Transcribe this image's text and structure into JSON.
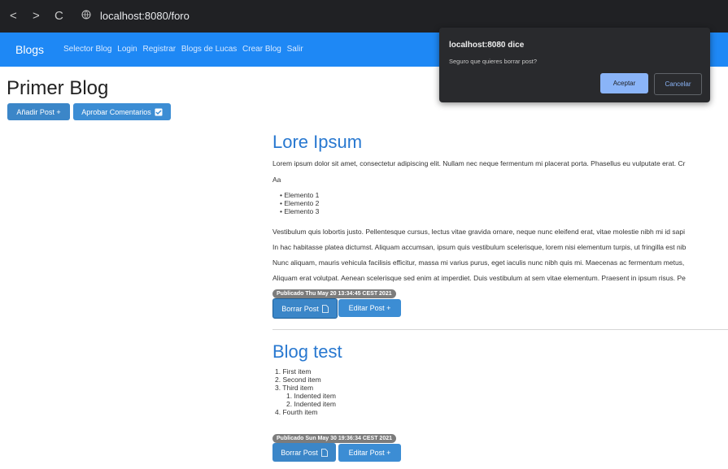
{
  "browser": {
    "back": "<",
    "forward": ">",
    "reload": "C",
    "url": "localhost:8080/foro"
  },
  "navbar": {
    "brand": "Blogs",
    "links": [
      "Selector Blog",
      "Login",
      "Registrar",
      "Blogs de Lucas",
      "Crear Blog",
      "Salir"
    ]
  },
  "page": {
    "title": "Primer Blog",
    "add_post": "Añadir Post +",
    "approve_comments": "Aprobar Comentarios"
  },
  "posts": [
    {
      "title": "Lore Ipsum",
      "paragraphs": [
        "Lorem ipsum dolor sit amet, consectetur adipiscing elit. Nullam nec neque fermentum mi placerat porta. Phasellus eu vulputate erat. Cr",
        "Aa",
        "Vestibulum quis lobortis justo. Pellentesque cursus, lectus vitae gravida ornare, neque nunc eleifend erat, vitae molestie nibh mi id sapi",
        "In hac habitasse platea dictumst. Aliquam accumsan, ipsum quis vestibulum scelerisque, lorem nisi elementum turpis, ut fringilla est nib",
        "Nunc aliquam, mauris vehicula facilisis efficitur, massa mi varius purus, eget iaculis nunc nibh quis mi. Maecenas ac fermentum metus,",
        "Aliquam erat volutpat. Aenean scelerisque sed enim at imperdiet. Duis vestibulum at sem vitae elementum. Praesent in ipsum risus. Pe"
      ],
      "list": [
        "Elemento 1",
        "Elemento 2",
        "Elemento 3"
      ],
      "badge": "Publicado Thu May 20 13:34:45 CEST 2021",
      "delete_label": "Borrar Post",
      "edit_label": "Editar Post +"
    },
    {
      "title": "Blog test",
      "ordered": [
        "First item",
        "Second item",
        "Third item",
        "Fourth item"
      ],
      "nested": [
        "Indented item",
        "Indented item"
      ],
      "badge": "Publicado Sun May 30 19:36:34 CEST 2021",
      "delete_label": "Borrar Post",
      "edit_label": "Editar Post +"
    }
  ],
  "dialog": {
    "title": "localhost:8080 dice",
    "message": "Seguro que quieres borrar post?",
    "accept": "Aceptar",
    "cancel": "Cancelar"
  }
}
